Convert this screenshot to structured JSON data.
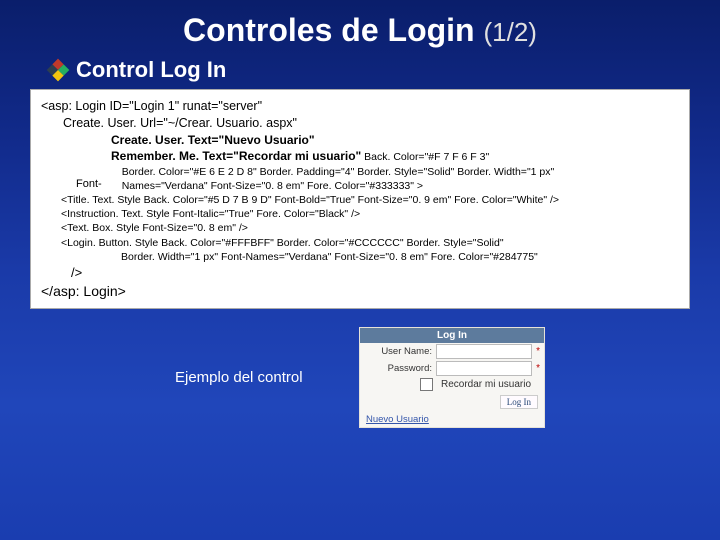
{
  "title_main": "Controles de Login",
  "title_fraction": "(1/2)",
  "section_heading": "Control Log In",
  "code": {
    "line_open": "<asp: Login ID=\"Login 1\" runat=\"server\"",
    "line_createurl": "Create. User. Url=\"~/Crear. Usuario. aspx\"",
    "line_createtext": "Create. User. Text=\"Nuevo Usuario\"",
    "line_remember_a": "Remember. Me. Text=\"Recordar mi usuario\"",
    "line_remember_b": " Back. Color=\"#F 7 F 6 F 3\"",
    "font_label": "Font-",
    "line_border": "Border. Color=\"#E 6 E 2 D 8\" Border. Padding=\"4\" Border. Style=\"Solid\" Border. Width=\"1 px\"",
    "line_names": "Names=\"Verdana\" Font-Size=\"0. 8 em\" Fore. Color=\"#333333\" >",
    "sub1": "<Title. Text. Style Back. Color=\"#5 D 7 B 9 D\" Font-Bold=\"True\" Font-Size=\"0. 9 em\" Fore. Color=\"White\" />",
    "sub2": "<Instruction. Text. Style Font-Italic=\"True\" Fore. Color=\"Black\" />",
    "sub3": "<Text. Box. Style Font-Size=\"0. 8 em\" />",
    "sub4a": "<Login. Button. Style Back. Color=\"#FFFBFF\" Border. Color=\"#CCCCCC\" Border. Style=\"Solid\"",
    "sub4b": "Border. Width=\"1 px\" Font-Names=\"Verdana\" Font-Size=\"0. 8 em\" Fore. Color=\"#284775\"",
    "close_tag": "/>",
    "close_login": "</asp: Login>"
  },
  "caption": "Ejemplo del control",
  "widget": {
    "title": "Log In",
    "user_label": "User Name:",
    "pass_label": "Password:",
    "remember_label": "Recordar mi usuario",
    "button_label": "Log In",
    "create_link": "Nuevo Usuario"
  }
}
